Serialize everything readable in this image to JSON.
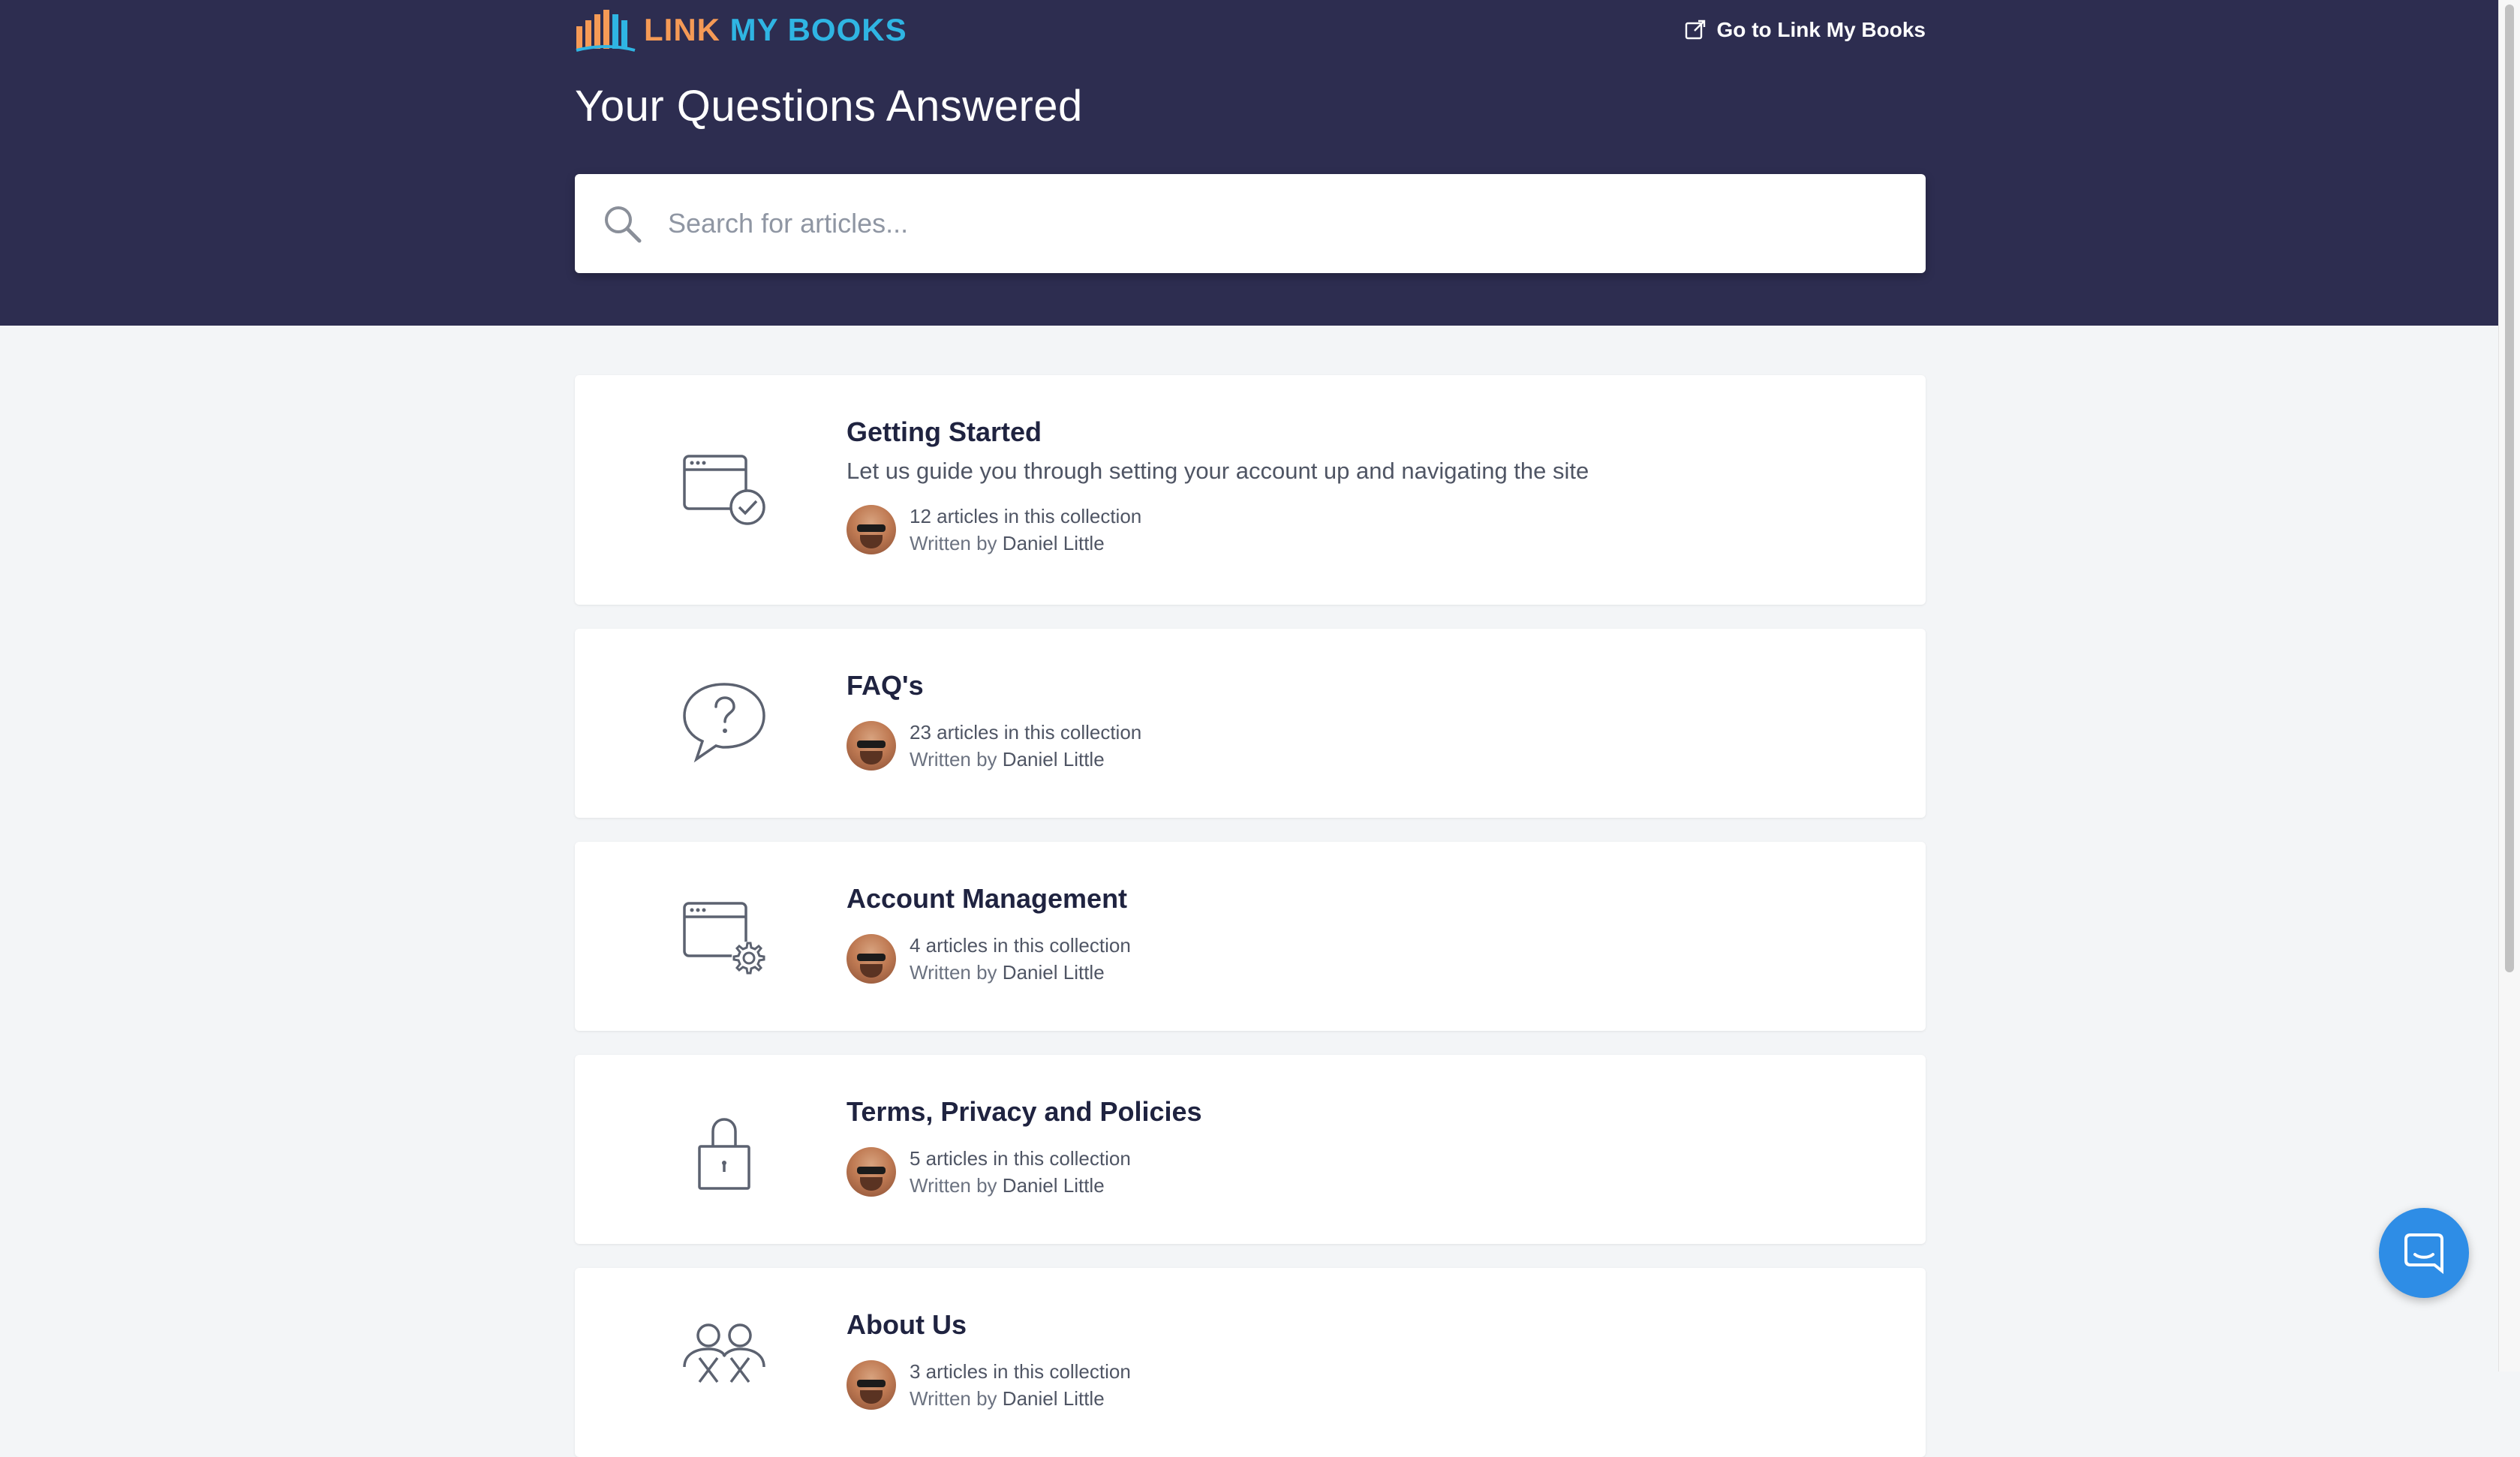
{
  "brand": {
    "logo_word1": "LINK",
    "logo_word2": "MY BOOKS",
    "logo_color_orange": "#f59a56",
    "logo_color_blue": "#2fb5e3"
  },
  "header": {
    "goto_link": "Go to Link My Books",
    "title": "Your Questions Answered",
    "background": "#2d2d50"
  },
  "search": {
    "placeholder": "Search for articles..."
  },
  "collections": [
    {
      "title": "Getting Started",
      "description": "Let us guide you through setting your account up and navigating the site",
      "count_text": "12 articles in this collection",
      "written_by": "Written by",
      "author": "Daniel Little",
      "icon": "browser-check-icon"
    },
    {
      "title": "FAQ's",
      "count_text": "23 articles in this collection",
      "written_by": "Written by",
      "author": "Daniel Little",
      "icon": "speech-question-icon"
    },
    {
      "title": "Account Management",
      "count_text": "4 articles in this collection",
      "written_by": "Written by",
      "author": "Daniel Little",
      "icon": "browser-gear-icon"
    },
    {
      "title": "Terms, Privacy and Policies",
      "count_text": "5 articles in this collection",
      "written_by": "Written by",
      "author": "Daniel Little",
      "icon": "padlock-icon"
    },
    {
      "title": "About Us",
      "count_text": "3 articles in this collection",
      "written_by": "Written by",
      "author": "Daniel Little",
      "icon": "people-icon"
    }
  ],
  "chat": {
    "icon": "chat-bubble-icon",
    "color": "#2e8de6"
  }
}
